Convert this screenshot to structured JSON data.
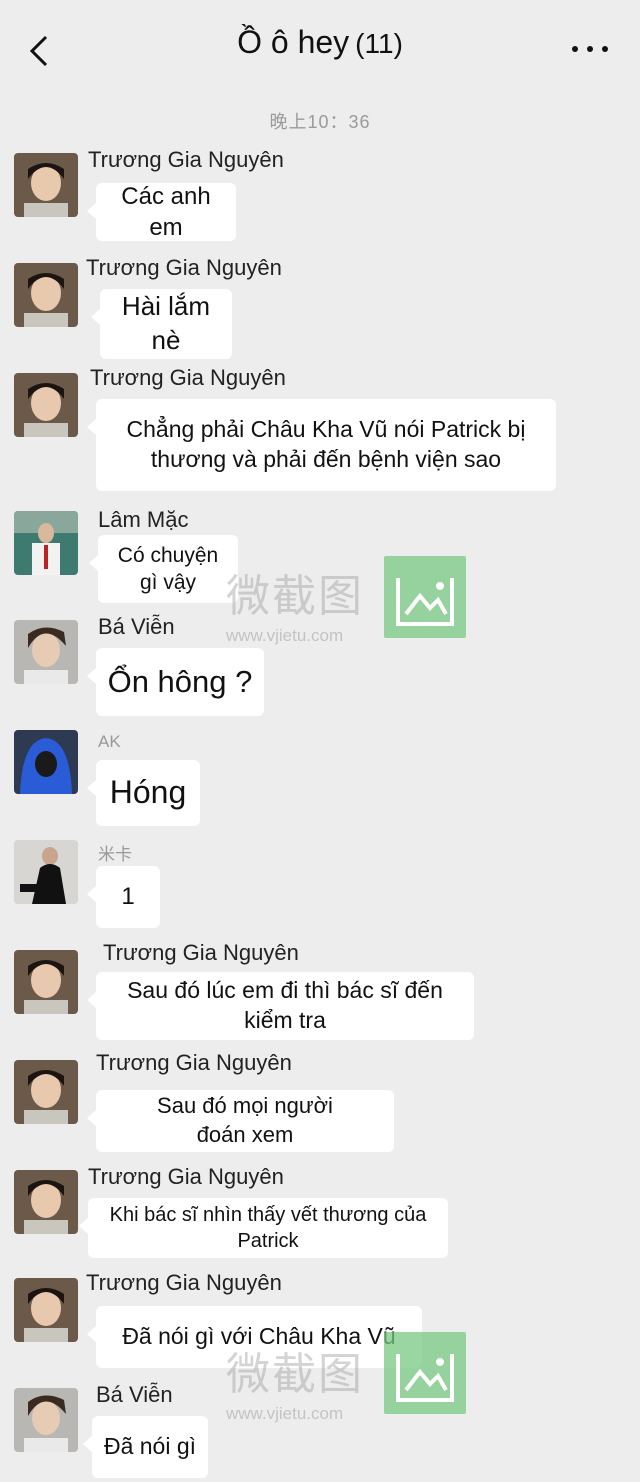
{
  "header": {
    "title": "Ồ ô hey",
    "member_count": "(11)"
  },
  "timestamp": "晚上10：36",
  "messages": [
    {
      "sender": "Trương Gia Nguyên",
      "text": "Các anh em"
    },
    {
      "sender": "Trương Gia Nguyên",
      "text": "Hài lắm nè"
    },
    {
      "sender": "Trương Gia Nguyên",
      "text": "Chẳng phải Châu Kha Vũ nói Patrick bị thương và phải đến bệnh viện sao"
    },
    {
      "sender": "Lâm Mặc",
      "text": "Có chuyện gì vậy"
    },
    {
      "sender": "Bá Viễn",
      "text": "Ổn hông ?"
    },
    {
      "sender": "AK",
      "text": "Hóng"
    },
    {
      "sender": "米卡",
      "text": "1"
    },
    {
      "sender": "Trương Gia Nguyên",
      "text": "Sau đó lúc em đi thì bác sĩ đến kiểm tra"
    },
    {
      "sender": "Trương Gia Nguyên",
      "text": "Sau đó mọi người đoán xem"
    },
    {
      "sender": "Trương Gia Nguyên",
      "text": "Khi bác sĩ nhìn thấy vết thương của Patrick"
    },
    {
      "sender": "Trương Gia Nguyên",
      "text": "Đã nói gì với Châu Kha Vũ"
    },
    {
      "sender": "Bá Viễn",
      "text": "Đã nói gì"
    }
  ],
  "watermark": {
    "text": "微截图",
    "url": "www.vjietu.com",
    "color": "#7cc98a"
  },
  "icons": {
    "back": "chevron-left-icon",
    "more": "more-dots-icon"
  }
}
